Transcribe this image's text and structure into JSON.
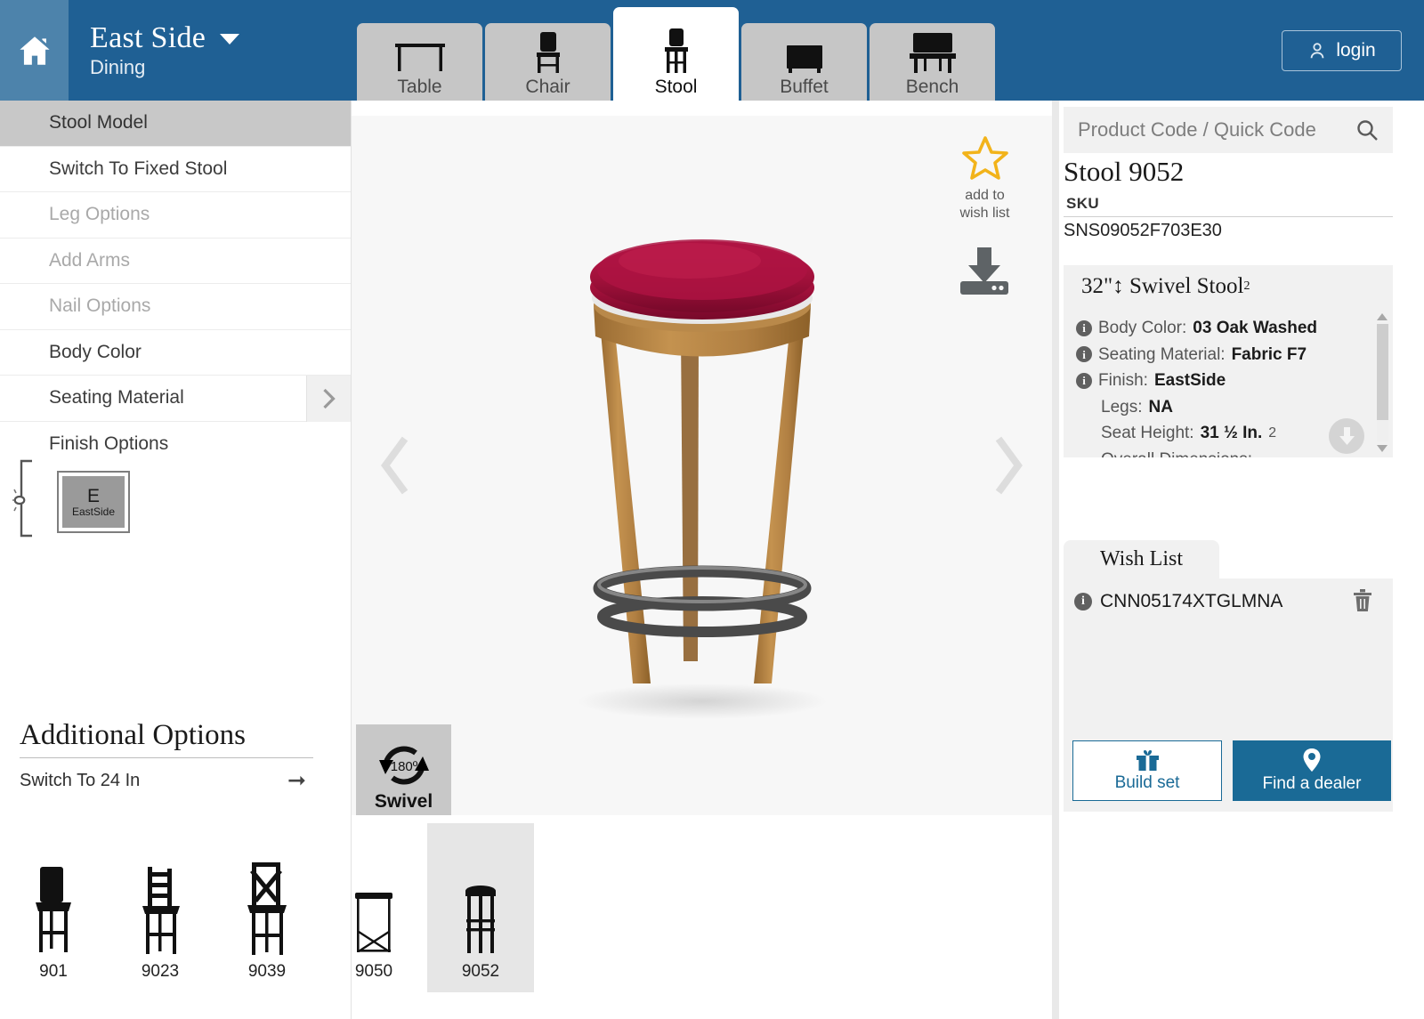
{
  "header": {
    "home_icon": "home-icon",
    "brand_title": "East Side",
    "brand_dropdown_icon": "chevron-down-icon",
    "brand_subtitle": "Dining",
    "login_label": "login",
    "login_icon": "user-icon",
    "tabs": [
      {
        "label": "Table",
        "icon": "table-icon",
        "active": false
      },
      {
        "label": "Chair",
        "icon": "chair-icon",
        "active": false
      },
      {
        "label": "Stool",
        "icon": "stool-icon",
        "active": true
      },
      {
        "label": "Buffet",
        "icon": "buffet-icon",
        "active": false
      },
      {
        "label": "Bench",
        "icon": "bench-icon",
        "active": false
      }
    ]
  },
  "sidebar": {
    "options": [
      {
        "label": "Stool Model",
        "state": "selected"
      },
      {
        "label": "Switch To Fixed Stool",
        "state": "normal"
      },
      {
        "label": "Leg Options",
        "state": "disabled"
      },
      {
        "label": "Add Arms",
        "state": "disabled"
      },
      {
        "label": "Nail Options",
        "state": "disabled"
      },
      {
        "label": "Body Color",
        "state": "normal"
      },
      {
        "label": "Seating Material",
        "state": "normal",
        "has_arrow": true
      }
    ],
    "finish_options_label": "Finish Options",
    "finish_swatch": {
      "letter": "E",
      "name": "EastSide",
      "color": "#9a9a9a"
    },
    "additional_options_title": "Additional Options",
    "additional_options": [
      {
        "label": "Switch To 24 In",
        "arrow_icon": "arrow-right-icon"
      }
    ]
  },
  "thumbnails": [
    {
      "label": "901",
      "selected": false
    },
    {
      "label": "9023",
      "selected": false
    },
    {
      "label": "9039",
      "selected": false
    },
    {
      "label": "9050",
      "selected": false
    },
    {
      "label": "9052",
      "selected": true
    }
  ],
  "viewer": {
    "wish_star_icon": "star-icon",
    "wish_star_line1": "add to",
    "wish_star_line2": "wish list",
    "download_icon": "download-icon",
    "prev_icon": "chevron-left-icon",
    "next_icon": "chevron-right-icon",
    "swivel_badge": {
      "degrees": "180º",
      "label": "Swivel",
      "icon": "rotate-icon"
    },
    "product_colors": {
      "seat_fabric": "#a8123f",
      "wood": "#b8864a",
      "metal_ring": "#4a4a4a",
      "background": "#f7f7f7"
    }
  },
  "right_panel": {
    "search_placeholder": "Product Code / Quick Code",
    "search_value": "",
    "search_icon": "search-icon",
    "product_title": "Stool 9052",
    "sku_label": "SKU",
    "sku_value": "SNS09052F703E30",
    "spec_header": "32\"↕ Swivel Stool",
    "spec_header_sup": "2",
    "specs": [
      {
        "label": "Body Color:",
        "value": "03 Oak Washed",
        "info": true
      },
      {
        "label": "Seating Material:",
        "value": "Fabric F7",
        "info": true
      },
      {
        "label": "Finish:",
        "value": "EastSide",
        "info": true
      },
      {
        "label": "Legs:",
        "value": "NA",
        "info": false
      },
      {
        "label": "Seat Height:",
        "value": "31 ½ In.",
        "value_sup": "2",
        "info": false
      },
      {
        "label": "Overall Dimensions:",
        "value": "",
        "info": false
      }
    ],
    "scroll_down_icon": "arrow-down-circle-icon",
    "wish_list": {
      "tab_label": "Wish List",
      "items": [
        {
          "code": "CNN05174XTGLMNA",
          "info_icon": "info-icon",
          "delete_icon": "trash-icon"
        }
      ],
      "build_set_label": "Build set",
      "build_set_icon": "gift-icon",
      "find_dealer_label": "Find a dealer",
      "find_dealer_icon": "map-pin-icon"
    }
  },
  "colors": {
    "header_blue": "#1f6094",
    "home_blue": "#4d83ab",
    "accent_teal": "#1a6a96",
    "star_gold": "#f2b31a",
    "tab_gray": "#c6c6c6"
  }
}
